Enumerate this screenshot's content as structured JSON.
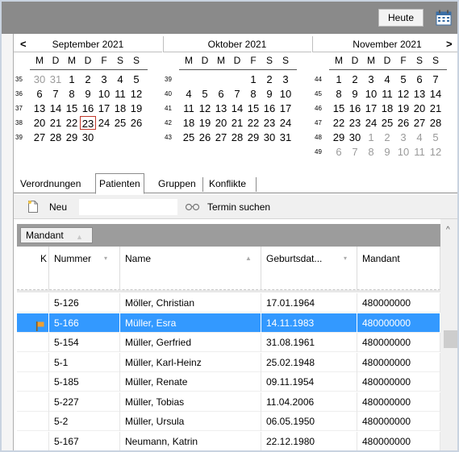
{
  "header": {
    "today_button": "Heute",
    "calendar_icon": "calendar-icon"
  },
  "calendar": {
    "prev_arrow": "<",
    "next_arrow": ">",
    "months": [
      {
        "title": "September 2021",
        "dow": [
          "M",
          "D",
          "M",
          "D",
          "F",
          "S",
          "S"
        ],
        "weeks": [
          {
            "wk": "35",
            "days": [
              "30",
              "31",
              "1",
              "2",
              "3",
              "4",
              "5"
            ],
            "grey": [
              0,
              1
            ]
          },
          {
            "wk": "36",
            "days": [
              "6",
              "7",
              "8",
              "9",
              "10",
              "11",
              "12"
            ],
            "grey": []
          },
          {
            "wk": "37",
            "days": [
              "13",
              "14",
              "15",
              "16",
              "17",
              "18",
              "19"
            ],
            "grey": []
          },
          {
            "wk": "38",
            "days": [
              "20",
              "21",
              "22",
              "23",
              "24",
              "25",
              "26"
            ],
            "grey": [],
            "today": 3
          },
          {
            "wk": "39",
            "days": [
              "27",
              "28",
              "29",
              "30",
              "",
              "",
              ""
            ],
            "grey": []
          }
        ]
      },
      {
        "title": "Oktober 2021",
        "dow": [
          "M",
          "D",
          "M",
          "D",
          "F",
          "S",
          "S"
        ],
        "weeks": [
          {
            "wk": "39",
            "days": [
              "",
              "",
              "",
              "",
              "1",
              "2",
              "3"
            ],
            "grey": []
          },
          {
            "wk": "40",
            "days": [
              "4",
              "5",
              "6",
              "7",
              "8",
              "9",
              "10"
            ],
            "grey": []
          },
          {
            "wk": "41",
            "days": [
              "11",
              "12",
              "13",
              "14",
              "15",
              "16",
              "17"
            ],
            "grey": []
          },
          {
            "wk": "42",
            "days": [
              "18",
              "19",
              "20",
              "21",
              "22",
              "23",
              "24"
            ],
            "grey": []
          },
          {
            "wk": "43",
            "days": [
              "25",
              "26",
              "27",
              "28",
              "29",
              "30",
              "31"
            ],
            "grey": []
          }
        ]
      },
      {
        "title": "November 2021",
        "dow": [
          "M",
          "D",
          "M",
          "D",
          "F",
          "S",
          "S"
        ],
        "weeks": [
          {
            "wk": "44",
            "days": [
              "1",
              "2",
              "3",
              "4",
              "5",
              "6",
              "7"
            ],
            "grey": []
          },
          {
            "wk": "45",
            "days": [
              "8",
              "9",
              "10",
              "11",
              "12",
              "13",
              "14"
            ],
            "grey": []
          },
          {
            "wk": "46",
            "days": [
              "15",
              "16",
              "17",
              "18",
              "19",
              "20",
              "21"
            ],
            "grey": []
          },
          {
            "wk": "47",
            "days": [
              "22",
              "23",
              "24",
              "25",
              "26",
              "27",
              "28"
            ],
            "grey": []
          },
          {
            "wk": "48",
            "days": [
              "29",
              "30",
              "1",
              "2",
              "3",
              "4",
              "5"
            ],
            "grey": [
              2,
              3,
              4,
              5,
              6
            ]
          },
          {
            "wk": "49",
            "days": [
              "6",
              "7",
              "8",
              "9",
              "10",
              "11",
              "12"
            ],
            "grey": [
              0,
              1,
              2,
              3,
              4,
              5,
              6
            ]
          }
        ]
      }
    ]
  },
  "tabs": [
    {
      "label": "Verordnungen",
      "active": false
    },
    {
      "label": "Patienten",
      "active": true
    },
    {
      "label": "Gruppen",
      "active": false
    },
    {
      "label": "Konflikte",
      "active": false
    }
  ],
  "toolbar": {
    "new_label": "Neu",
    "search_value": "",
    "find_appointment_label": "Termin suchen"
  },
  "grid": {
    "group_chip": "Mandant",
    "columns": [
      "K",
      "Nummer",
      "Name",
      "Geburtsdat...",
      "Mandant"
    ],
    "rows": [
      {
        "flag": false,
        "nummer": "5-126",
        "name": "Möller, Christian",
        "geburtsdatum": "17.01.1964",
        "mandant": "480000000",
        "selected": false
      },
      {
        "flag": true,
        "nummer": "5-166",
        "name": "Müller, Esra",
        "geburtsdatum": "14.11.1983",
        "mandant": "480000000",
        "selected": true
      },
      {
        "flag": false,
        "nummer": "5-154",
        "name": "Müller, Gerfried",
        "geburtsdatum": "31.08.1961",
        "mandant": "480000000",
        "selected": false
      },
      {
        "flag": false,
        "nummer": "5-1",
        "name": "Müller, Karl-Heinz",
        "geburtsdatum": "25.02.1948",
        "mandant": "480000000",
        "selected": false
      },
      {
        "flag": false,
        "nummer": "5-185",
        "name": "Müller, Renate",
        "geburtsdatum": "09.11.1954",
        "mandant": "480000000",
        "selected": false
      },
      {
        "flag": false,
        "nummer": "5-227",
        "name": "Müller, Tobias",
        "geburtsdatum": "11.04.2006",
        "mandant": "480000000",
        "selected": false
      },
      {
        "flag": false,
        "nummer": "5-2",
        "name": "Müller, Ursula",
        "geburtsdatum": "06.05.1950",
        "mandant": "480000000",
        "selected": false
      },
      {
        "flag": false,
        "nummer": "5-167",
        "name": "Neumann, Katrin",
        "geburtsdatum": "22.12.1980",
        "mandant": "480000000",
        "selected": false
      }
    ]
  },
  "colors": {
    "selection": "#3399ff",
    "today_border": "#c0392b",
    "flag": "#f0a030"
  }
}
